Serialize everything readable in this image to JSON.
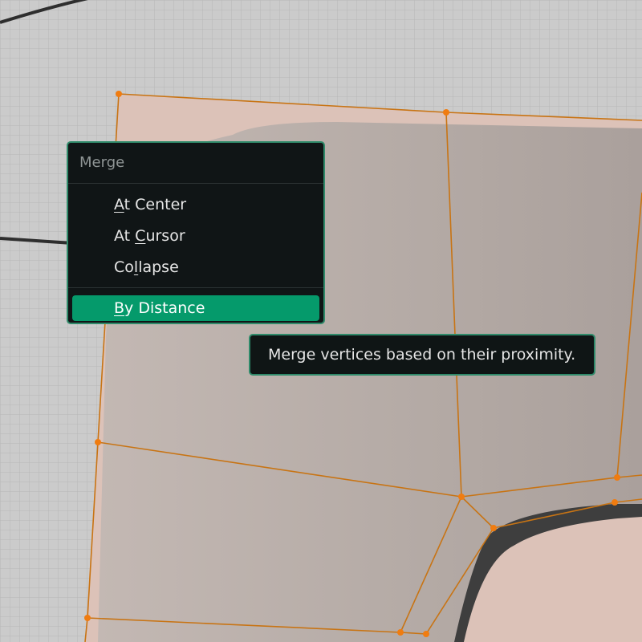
{
  "colors": {
    "menu_bg": "#101516",
    "accent_border": "#2f8a6a",
    "active_item": "#059a6b",
    "edge": "#c87414",
    "vertex": "#f07c10"
  },
  "menu": {
    "title": "Merge",
    "items": [
      {
        "label": "At Center",
        "pre": "",
        "mnemonic": "A",
        "post": "t Center",
        "active": false
      },
      {
        "label": "At Cursor",
        "pre": "At ",
        "mnemonic": "C",
        "post": "ursor",
        "active": false
      },
      {
        "label": "Collapse",
        "pre": "Co",
        "mnemonic": "l",
        "post": "lapse",
        "active": false
      },
      {
        "label": "By Distance",
        "pre": "",
        "mnemonic": "B",
        "post": "y Distance",
        "active": true
      }
    ]
  },
  "tooltip": {
    "text": "Merge vertices based on their proximity."
  }
}
